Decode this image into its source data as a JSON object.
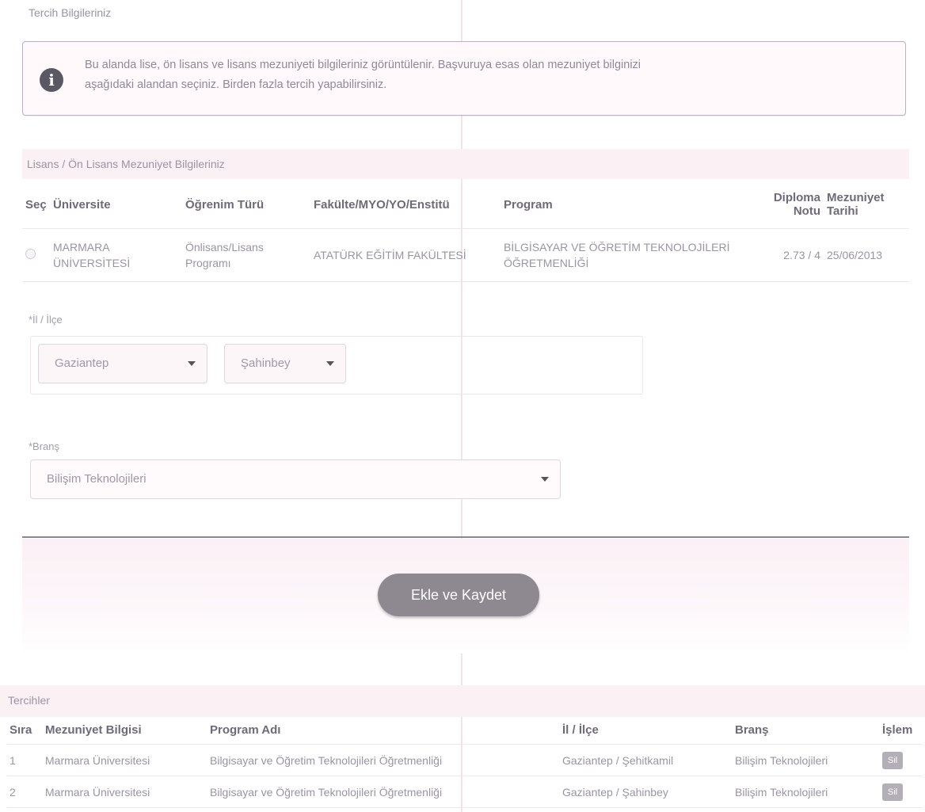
{
  "section": {
    "tercih_bilgileri": "Tercih Bilgileriniz",
    "mezuniyet_title": "Lisans / Ön Lisans Mezuniyet Bilgileriniz",
    "tercihler_title": "Tercihler"
  },
  "info": {
    "line1": "Bu alanda lise, ön lisans ve lisans mezuniyeti bilgileriniz görüntülenir. Başvuruya esas olan mezuniyet bilginizi",
    "line2": "aşağıdaki alandan seçiniz. Birden fazla tercih yapabilirsiniz.",
    "icon": "info-icon"
  },
  "grad_table": {
    "headers": {
      "sec": "Seç",
      "universite": "Üniversite",
      "ogrenim": "Öğrenim Türü",
      "fakulte": "Fakülte/MYO/YO/Enstitü",
      "program": "Program",
      "diploma": "Diploma Notu",
      "mezuniyet": "Mezuniyet Tarihi"
    },
    "row": {
      "universite": "MARMARA ÜNİVERSİTESİ",
      "ogrenim": "Önlisans/Lisans Programı",
      "fakulte": "ATATÜRK EĞİTİM FAKÜLTESİ",
      "program": "BİLGİSAYAR VE ÖĞRETİM TEKNOLOJİLERİ ÖĞRETMENLİĞİ",
      "diploma": "2.73 / 4",
      "mezuniyet": "25/06/2013"
    }
  },
  "form": {
    "il_ilce_label": "*İl / İlçe",
    "il_value": "Gaziantep",
    "ilce_value": "Şahinbey",
    "brans_label": "*Branş",
    "brans_value": "Bilişim Teknolojileri",
    "save_label": "Ekle ve Kaydet"
  },
  "pref_table": {
    "headers": {
      "sira": "Sıra",
      "mezuniyet": "Mezuniyet Bilgisi",
      "program": "Program Adı",
      "il_ilce": "İl / İlçe",
      "brans": "Branş",
      "islem": "İşlem"
    },
    "rows": [
      {
        "sira": "1",
        "mezuniyet": "Marmara Üniversitesi",
        "program": "Bilgisayar ve Öğretim Teknolojileri Öğretmenliği",
        "il_ilce": "Gaziantep / Şehitkamil",
        "brans": "Bilişim Teknolojileri",
        "islem": "Sil"
      },
      {
        "sira": "2",
        "mezuniyet": "Marmara Üniversitesi",
        "program": "Bilgisayar ve Öğretim Teknolojileri Öğretmenliği",
        "il_ilce": "Gaziantep / Şahinbey",
        "brans": "Bilişim Teknolojileri",
        "islem": "Sil"
      }
    ]
  }
}
